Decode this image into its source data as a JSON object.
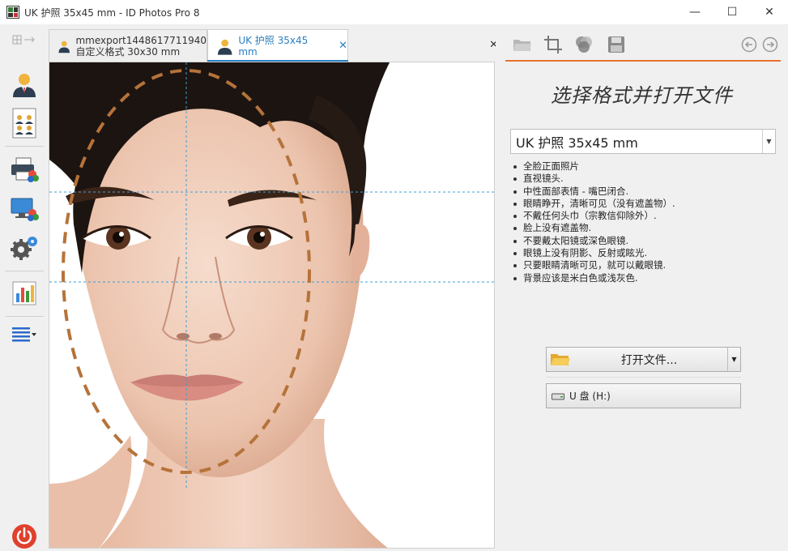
{
  "window": {
    "title": "UK 护照 35x45 mm - ID Photos Pro 8",
    "minimize": "—",
    "maximize": "☐",
    "close": "✕"
  },
  "tabs": [
    {
      "line1": "mmexport1448617711940",
      "line2": "自定义格式 30x30 mm",
      "active": false
    },
    {
      "line1": "UK 护照 35x45 mm",
      "close": "✕",
      "active": true
    }
  ],
  "tabbar_close": "✕",
  "right_panel": {
    "title": "选择格式并打开文件",
    "format_selected": "UK 护照 35x45 mm",
    "dropdown_arrow": "▼",
    "requirements": [
      "全脸正面照片",
      "直视镜头.",
      "中性面部表情 - 嘴巴闭合.",
      "眼睛睁开，清晰可见（没有遮盖物）.",
      "不戴任何头巾（宗教信仰除外）.",
      "脸上没有遮盖物.",
      "不要戴太阳镜或深色眼镜.",
      "眼镜上没有阴影、反射或眩光.",
      "只要眼睛清晰可见，就可以戴眼镜.",
      "背景应该是米白色或浅灰色."
    ],
    "open_file_label": "打开文件...",
    "drive_label": "U 盘 (H:)"
  },
  "colors": {
    "accent": "#e8722c",
    "tab_active_text": "#2a7fbf",
    "guide_line": "#3aa0d8",
    "face_oval": "#b5733a"
  },
  "icons": {
    "left_toolbar": [
      "layout-icon",
      "person-icon",
      "group-sheet-icon",
      "print-icon",
      "monitor-icon",
      "settings-icon",
      "chart-icon",
      "menu-icon",
      "power-icon"
    ],
    "right_toolbar": [
      "open-folder-icon",
      "crop-icon",
      "color-icon",
      "save-icon",
      "back-icon",
      "forward-icon"
    ]
  }
}
